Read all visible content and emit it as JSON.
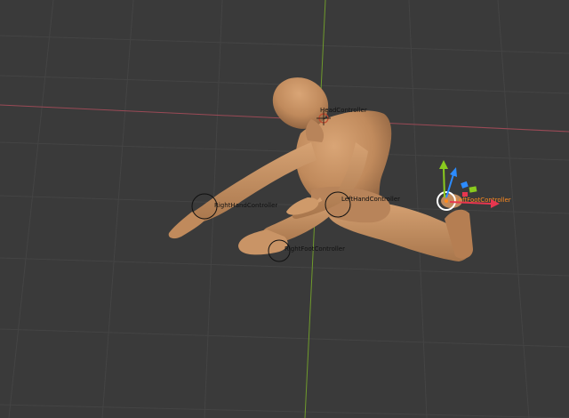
{
  "viewport": {
    "background": "#3a3a3a",
    "grid_color": "#444444",
    "x_axis_color": "#9a4a56",
    "y_axis_color": "#6f9a2c"
  },
  "figure": {
    "body_color": "#c08a5c",
    "shade_color": "#9a6b43"
  },
  "controllers": {
    "head": "HeadController",
    "left_hand": "LeftHandController",
    "right_hand": "RightHandController",
    "right_foot": "RightFootController",
    "left_foot": "LeftFootController"
  },
  "gizmo": {
    "x_color": "#e8364f",
    "y_color": "#8acb1e",
    "z_color": "#2c8cff",
    "active_color": "#ff8a1e"
  }
}
